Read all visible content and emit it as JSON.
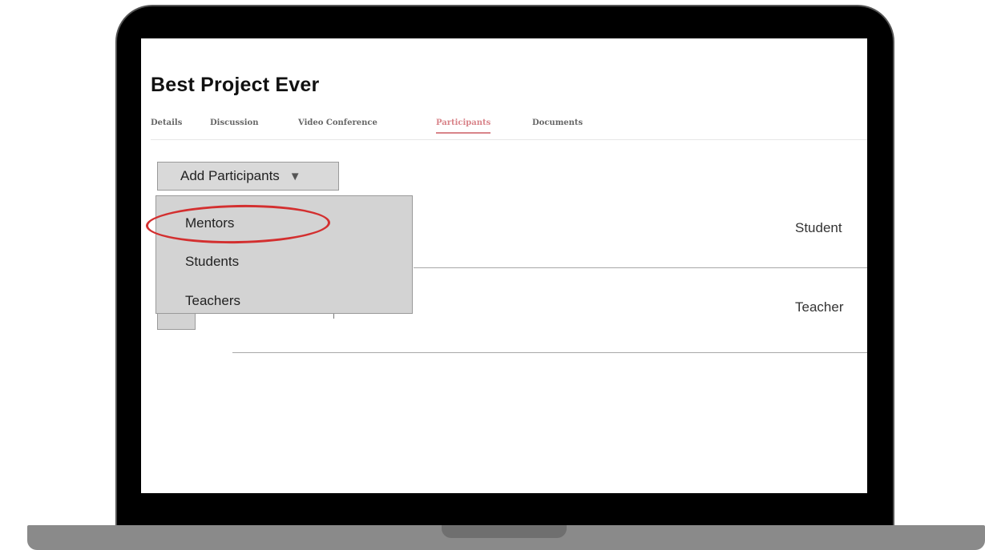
{
  "page": {
    "title": "Best Project Ever"
  },
  "tabs": [
    {
      "label": "Details",
      "active": false
    },
    {
      "label": "Discussion",
      "active": false
    },
    {
      "label": "Video Conference",
      "active": false
    },
    {
      "label": "Participants",
      "active": true
    },
    {
      "label": "Documents",
      "active": false
    }
  ],
  "add_button": {
    "label": "Add Participants",
    "caret": "▼"
  },
  "dropdown": {
    "items": [
      "Mentors",
      "Students",
      "Teachers"
    ],
    "highlighted": "Mentors"
  },
  "participants": [
    {
      "role": "Student"
    },
    {
      "role": "Teacher"
    }
  ],
  "colors": {
    "active_tab": "#d9848a",
    "highlight_ring": "#d32f2f",
    "laptop_frame": "#000000",
    "laptop_base": "#8a8a8a",
    "dropdown_bg": "#d3d3d3"
  }
}
